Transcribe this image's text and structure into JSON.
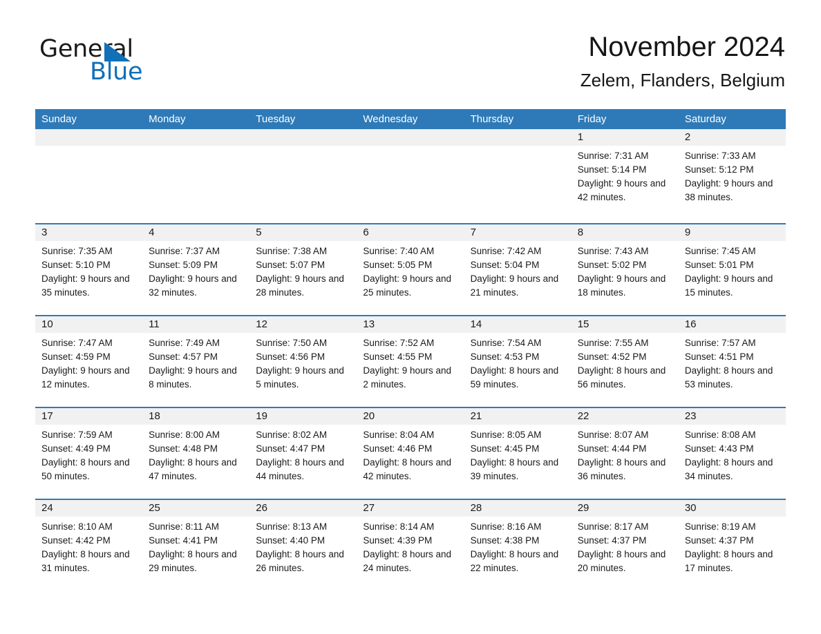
{
  "brand": {
    "name_part1": "General",
    "name_part2": "Blue",
    "accent_color": "#1070b8",
    "triangle_icon": "brand-triangle-icon"
  },
  "header": {
    "title": "November 2024",
    "subtitle": "Zelem, Flanders, Belgium"
  },
  "theme": {
    "header_blue": "#2e7ab8",
    "daynum_band": "#f1f1f1",
    "text": "#1a1a1a"
  },
  "weekdays": [
    "Sunday",
    "Monday",
    "Tuesday",
    "Wednesday",
    "Thursday",
    "Friday",
    "Saturday"
  ],
  "weeks": [
    [
      {
        "day": "",
        "sunrise": "",
        "sunset": "",
        "daylight": "",
        "empty": true
      },
      {
        "day": "",
        "sunrise": "",
        "sunset": "",
        "daylight": "",
        "empty": true
      },
      {
        "day": "",
        "sunrise": "",
        "sunset": "",
        "daylight": "",
        "empty": true
      },
      {
        "day": "",
        "sunrise": "",
        "sunset": "",
        "daylight": "",
        "empty": true
      },
      {
        "day": "",
        "sunrise": "",
        "sunset": "",
        "daylight": "",
        "empty": true
      },
      {
        "day": "1",
        "sunrise": "Sunrise: 7:31 AM",
        "sunset": "Sunset: 5:14 PM",
        "daylight": "Daylight: 9 hours and 42 minutes."
      },
      {
        "day": "2",
        "sunrise": "Sunrise: 7:33 AM",
        "sunset": "Sunset: 5:12 PM",
        "daylight": "Daylight: 9 hours and 38 minutes."
      }
    ],
    [
      {
        "day": "3",
        "sunrise": "Sunrise: 7:35 AM",
        "sunset": "Sunset: 5:10 PM",
        "daylight": "Daylight: 9 hours and 35 minutes."
      },
      {
        "day": "4",
        "sunrise": "Sunrise: 7:37 AM",
        "sunset": "Sunset: 5:09 PM",
        "daylight": "Daylight: 9 hours and 32 minutes."
      },
      {
        "day": "5",
        "sunrise": "Sunrise: 7:38 AM",
        "sunset": "Sunset: 5:07 PM",
        "daylight": "Daylight: 9 hours and 28 minutes."
      },
      {
        "day": "6",
        "sunrise": "Sunrise: 7:40 AM",
        "sunset": "Sunset: 5:05 PM",
        "daylight": "Daylight: 9 hours and 25 minutes."
      },
      {
        "day": "7",
        "sunrise": "Sunrise: 7:42 AM",
        "sunset": "Sunset: 5:04 PM",
        "daylight": "Daylight: 9 hours and 21 minutes."
      },
      {
        "day": "8",
        "sunrise": "Sunrise: 7:43 AM",
        "sunset": "Sunset: 5:02 PM",
        "daylight": "Daylight: 9 hours and 18 minutes."
      },
      {
        "day": "9",
        "sunrise": "Sunrise: 7:45 AM",
        "sunset": "Sunset: 5:01 PM",
        "daylight": "Daylight: 9 hours and 15 minutes."
      }
    ],
    [
      {
        "day": "10",
        "sunrise": "Sunrise: 7:47 AM",
        "sunset": "Sunset: 4:59 PM",
        "daylight": "Daylight: 9 hours and 12 minutes."
      },
      {
        "day": "11",
        "sunrise": "Sunrise: 7:49 AM",
        "sunset": "Sunset: 4:57 PM",
        "daylight": "Daylight: 9 hours and 8 minutes."
      },
      {
        "day": "12",
        "sunrise": "Sunrise: 7:50 AM",
        "sunset": "Sunset: 4:56 PM",
        "daylight": "Daylight: 9 hours and 5 minutes."
      },
      {
        "day": "13",
        "sunrise": "Sunrise: 7:52 AM",
        "sunset": "Sunset: 4:55 PM",
        "daylight": "Daylight: 9 hours and 2 minutes."
      },
      {
        "day": "14",
        "sunrise": "Sunrise: 7:54 AM",
        "sunset": "Sunset: 4:53 PM",
        "daylight": "Daylight: 8 hours and 59 minutes."
      },
      {
        "day": "15",
        "sunrise": "Sunrise: 7:55 AM",
        "sunset": "Sunset: 4:52 PM",
        "daylight": "Daylight: 8 hours and 56 minutes."
      },
      {
        "day": "16",
        "sunrise": "Sunrise: 7:57 AM",
        "sunset": "Sunset: 4:51 PM",
        "daylight": "Daylight: 8 hours and 53 minutes."
      }
    ],
    [
      {
        "day": "17",
        "sunrise": "Sunrise: 7:59 AM",
        "sunset": "Sunset: 4:49 PM",
        "daylight": "Daylight: 8 hours and 50 minutes."
      },
      {
        "day": "18",
        "sunrise": "Sunrise: 8:00 AM",
        "sunset": "Sunset: 4:48 PM",
        "daylight": "Daylight: 8 hours and 47 minutes."
      },
      {
        "day": "19",
        "sunrise": "Sunrise: 8:02 AM",
        "sunset": "Sunset: 4:47 PM",
        "daylight": "Daylight: 8 hours and 44 minutes."
      },
      {
        "day": "20",
        "sunrise": "Sunrise: 8:04 AM",
        "sunset": "Sunset: 4:46 PM",
        "daylight": "Daylight: 8 hours and 42 minutes."
      },
      {
        "day": "21",
        "sunrise": "Sunrise: 8:05 AM",
        "sunset": "Sunset: 4:45 PM",
        "daylight": "Daylight: 8 hours and 39 minutes."
      },
      {
        "day": "22",
        "sunrise": "Sunrise: 8:07 AM",
        "sunset": "Sunset: 4:44 PM",
        "daylight": "Daylight: 8 hours and 36 minutes."
      },
      {
        "day": "23",
        "sunrise": "Sunrise: 8:08 AM",
        "sunset": "Sunset: 4:43 PM",
        "daylight": "Daylight: 8 hours and 34 minutes."
      }
    ],
    [
      {
        "day": "24",
        "sunrise": "Sunrise: 8:10 AM",
        "sunset": "Sunset: 4:42 PM",
        "daylight": "Daylight: 8 hours and 31 minutes."
      },
      {
        "day": "25",
        "sunrise": "Sunrise: 8:11 AM",
        "sunset": "Sunset: 4:41 PM",
        "daylight": "Daylight: 8 hours and 29 minutes."
      },
      {
        "day": "26",
        "sunrise": "Sunrise: 8:13 AM",
        "sunset": "Sunset: 4:40 PM",
        "daylight": "Daylight: 8 hours and 26 minutes."
      },
      {
        "day": "27",
        "sunrise": "Sunrise: 8:14 AM",
        "sunset": "Sunset: 4:39 PM",
        "daylight": "Daylight: 8 hours and 24 minutes."
      },
      {
        "day": "28",
        "sunrise": "Sunrise: 8:16 AM",
        "sunset": "Sunset: 4:38 PM",
        "daylight": "Daylight: 8 hours and 22 minutes."
      },
      {
        "day": "29",
        "sunrise": "Sunrise: 8:17 AM",
        "sunset": "Sunset: 4:37 PM",
        "daylight": "Daylight: 8 hours and 20 minutes."
      },
      {
        "day": "30",
        "sunrise": "Sunrise: 8:19 AM",
        "sunset": "Sunset: 4:37 PM",
        "daylight": "Daylight: 8 hours and 17 minutes."
      }
    ]
  ]
}
